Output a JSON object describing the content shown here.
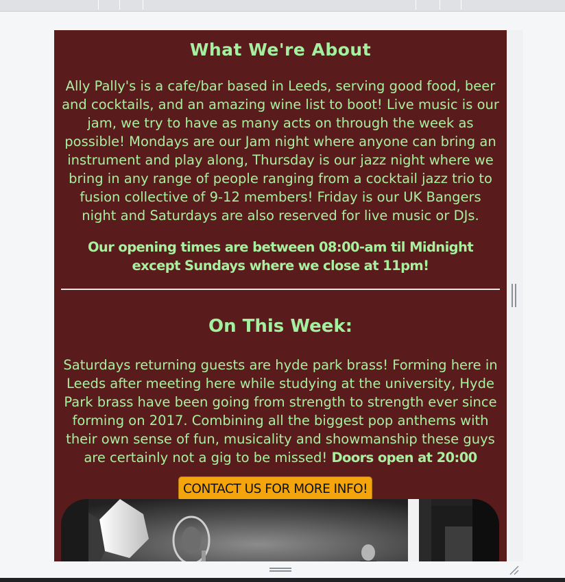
{
  "about": {
    "heading": "What We're About",
    "description": "Ally Pally's is a cafe/bar based in Leeds, serving good food, beer and cocktails, and an amazing wine list to boot! Live music is our jam, we try to have as many acts on through the week as possible! Mondays are our Jam night where anyone can bring an instrument and play along, Thursday is our jazz night where we bring in any range of people ranging from a cocktail jazz trio to fusion collective of 9-12 members! Friday is our UK Bangers night and Saturdays are also reserved for live music or DJs.",
    "opening_times": "Our opening times are between 08:00-am til Midnight except Sundays where we close at 11pm!"
  },
  "this_week": {
    "heading": "On This Week:",
    "description": "Saturdays returning guests are hyde park brass! Forming here in Leeds after meeting here while studying at the university, Hyde Park brass have been going from strength to strength ever since forming on 2017. Combining all the biggest pop anthems with their own sense of fun, musicality and showmanship these guys are certainly not a gig to be missed!",
    "doors": "Doors open at 20:00",
    "contact_button": "CONTACT US FOR MORE INFO!"
  },
  "colors": {
    "page_background": "#591b1b",
    "text": "#a8ef9f",
    "button": "#f5a50c"
  }
}
